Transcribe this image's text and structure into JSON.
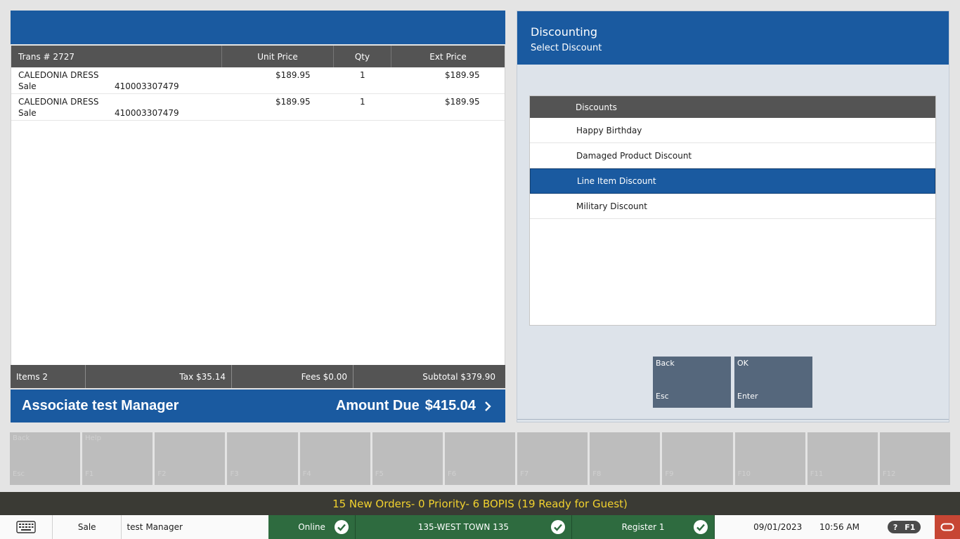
{
  "transaction": {
    "headers": {
      "trans_label": "Trans #",
      "trans_number": "2727",
      "unit_price": "Unit Price",
      "qty": "Qty",
      "ext_price": "Ext Price"
    },
    "items": [
      {
        "name": "CALEDONIA DRESS",
        "type": "Sale",
        "sku": "410003307479",
        "unit_price": "$189.95",
        "qty": "1",
        "ext_price": "$189.95"
      },
      {
        "name": "CALEDONIA DRESS",
        "type": "Sale",
        "sku": "410003307479",
        "unit_price": "$189.95",
        "qty": "1",
        "ext_price": "$189.95"
      }
    ],
    "totals": {
      "items": "Items 2",
      "tax": "Tax $35.14",
      "fees": "Fees $0.00",
      "subtotal": "Subtotal $379.90"
    },
    "associate": "Associate test Manager",
    "amount_due_label": "Amount Due",
    "amount_due": "$415.04"
  },
  "discounting": {
    "title": "Discounting",
    "subtitle": "Select Discount",
    "list_header": "Discounts",
    "items": [
      "Happy Birthday",
      "Damaged Product Discount",
      "Line Item Discount",
      "Military Discount"
    ],
    "selected": "Line Item Discount",
    "buttons": {
      "back": {
        "label": "Back",
        "key": "Esc"
      },
      "ok": {
        "label": "OK",
        "key": "Enter"
      }
    }
  },
  "function_keys": [
    {
      "label": "Back",
      "key": "Esc"
    },
    {
      "label": "Help",
      "key": "F1"
    },
    {
      "label": "",
      "key": "F2"
    },
    {
      "label": "",
      "key": "F3"
    },
    {
      "label": "",
      "key": "F4"
    },
    {
      "label": "",
      "key": "F5"
    },
    {
      "label": "",
      "key": "F6"
    },
    {
      "label": "",
      "key": "F7"
    },
    {
      "label": "",
      "key": "F8"
    },
    {
      "label": "",
      "key": "F9"
    },
    {
      "label": "",
      "key": "F10"
    },
    {
      "label": "",
      "key": "F11"
    },
    {
      "label": "",
      "key": "F12"
    }
  ],
  "notification": "15 New Orders- 0 Priority- 6 BOPIS (19 Ready for Guest)",
  "status_bar": {
    "mode": "Sale",
    "user": "test Manager",
    "online": "Online",
    "store": "135-WEST TOWN 135",
    "register": "Register 1",
    "date": "09/01/2023",
    "time": "10:56 AM",
    "help_q": "?",
    "help_key": "F1",
    "icons": {
      "keyboard": "keyboard-icon",
      "check": "check-circle-icon",
      "oracle": "oracle-logo-icon",
      "chevron": "chevron-right-icon"
    }
  },
  "colors": {
    "primary": "#1a5aa0",
    "header_gray": "#545454",
    "status_green": "#2e6b3f",
    "notify_yellow": "#f2d22e",
    "oracle_red": "#c74634"
  }
}
